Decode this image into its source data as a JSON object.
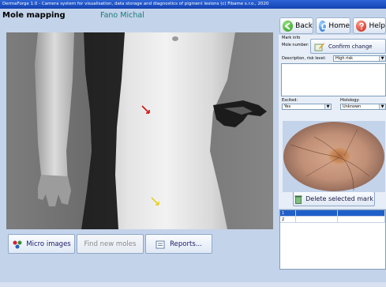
{
  "window": {
    "title": "DermaForge 1.0 - Camera system for visualisation, data storage and diagnostics of pigment lesions (c) Fibame s.r.o., 2020"
  },
  "header": {
    "mode_title": "Mole mapping",
    "patient_name": "Fano Michal"
  },
  "nav": {
    "back_label": "Back",
    "home_label": "Home",
    "help_label": "Help"
  },
  "mark_info": {
    "heading": "Mark info",
    "mole_number_label": "Mole number: 1",
    "confirm_label": "Confirm change",
    "description_label": "Description, risk level:",
    "risk_value": "High risk",
    "excited_label": "Excited:",
    "excited_value": "Yes",
    "histology_label": "Histology:",
    "histology_value": "Unknown",
    "delete_label": "Delete selected mark"
  },
  "bottom_buttons": {
    "micro_images_label": "Micro images",
    "find_new_moles_label": "Find new moles",
    "reports_label": "Reports..."
  },
  "marks_table": {
    "rows": [
      {
        "id": "1",
        "selected": true
      },
      {
        "id": "2",
        "selected": false
      }
    ]
  },
  "colors": {
    "background": "#c3d3ea",
    "titlebar": "#1f4fc4",
    "selected_row": "#1f5fc8",
    "mark_red": "#d01010",
    "mark_yellow": "#e8d020"
  },
  "icons": {
    "back": "back-arrow-icon",
    "home": "home-icon",
    "help": "help-icon",
    "confirm": "confirm-pen-icon",
    "delete": "delete-trash-icon",
    "micro_images": "micro-images-icon",
    "reports": "reports-icon"
  }
}
